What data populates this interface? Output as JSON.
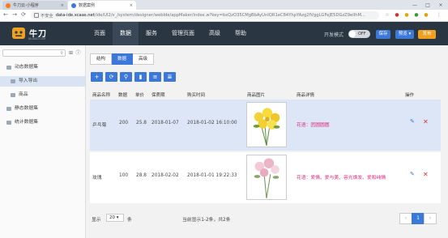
{
  "browser": {
    "tabs": [
      {
        "title": "牛刀云-小程序",
        "close": "×"
      },
      {
        "title": "数据案例",
        "close": "×"
      }
    ],
    "window_controls": [
      "—",
      "□",
      "×"
    ],
    "security_label": "不安全",
    "url_host": "data-ide.xcaas.net",
    "url_path": "/ide/UI2/v_/system/designer/webIde/appMaker/index.w?key=bxQzO35CMgBbAyUnIQR1eC84YhpYAzg2fVggLGFeJE5DGzZ9elIhM..."
  },
  "header": {
    "brand": "牛刀",
    "brand_sub": "NIUDAO.COM",
    "nav": [
      "页面",
      "数据",
      "服务",
      "管理页面",
      "高级",
      "帮助"
    ],
    "active_nav": 1,
    "devmode_label": "开发模式",
    "toggle_label": "OFF",
    "save_label": "保存",
    "preview_label": "预览 ▾",
    "publish_label": "发布"
  },
  "sidebar": {
    "items": [
      {
        "label": "动态数据集",
        "selected": false
      },
      {
        "label": "导入导出",
        "selected": true
      },
      {
        "label": "商品",
        "selected": false
      },
      {
        "label": "静态数据集",
        "selected": false
      },
      {
        "label": "统计数据集",
        "selected": false
      }
    ]
  },
  "designer": {
    "view_tabs": [
      "结构",
      "数据",
      "高级"
    ],
    "active_view_tab": 1,
    "toolbar_icons": [
      "add-icon",
      "refresh-icon",
      "search-icon",
      "delete-icon",
      "list-icon",
      "list-alt-icon"
    ],
    "toolbar_glyphs": [
      "+",
      "⟳",
      "⚲",
      "▮",
      "≡",
      "≣"
    ]
  },
  "table": {
    "columns": [
      "商品名称",
      "数据",
      "单价",
      "保质期",
      "购买时间",
      "商品图片",
      "商品详情",
      "操作"
    ],
    "rows": [
      {
        "name": "乒乓菊",
        "qty": "200",
        "price": "25.8",
        "expiry": "2018-01-07",
        "bought": "2018-01-02 16:10:00",
        "detail": "花语：团圆圆圆",
        "image": "yellow-chrysanthemum-bouquet"
      },
      {
        "name": "玫瑰",
        "qty": "100",
        "price": "28.8",
        "expiry": "2018-02-02",
        "bought": "2018-01-01 19:22:33",
        "detail": "花语：爱情、爱与美、容光焕发、爱和纯情",
        "image": "pink-rose-bouquet"
      }
    ],
    "edit_glyph": "✎",
    "delete_glyph": "✕"
  },
  "footer": {
    "show_label": "显示",
    "page_size": "20 ▾",
    "per_label": "条",
    "record_info": "当前显示1-2条，共2条",
    "pager": [
      "‹",
      "1",
      "›"
    ],
    "current_page": "1"
  },
  "colors": {
    "header_bg": "#2b3643",
    "primary": "#3c78d8",
    "publish": "#f0a020",
    "selected_row": "#dde6f6",
    "detail_text": "#e0287a"
  }
}
